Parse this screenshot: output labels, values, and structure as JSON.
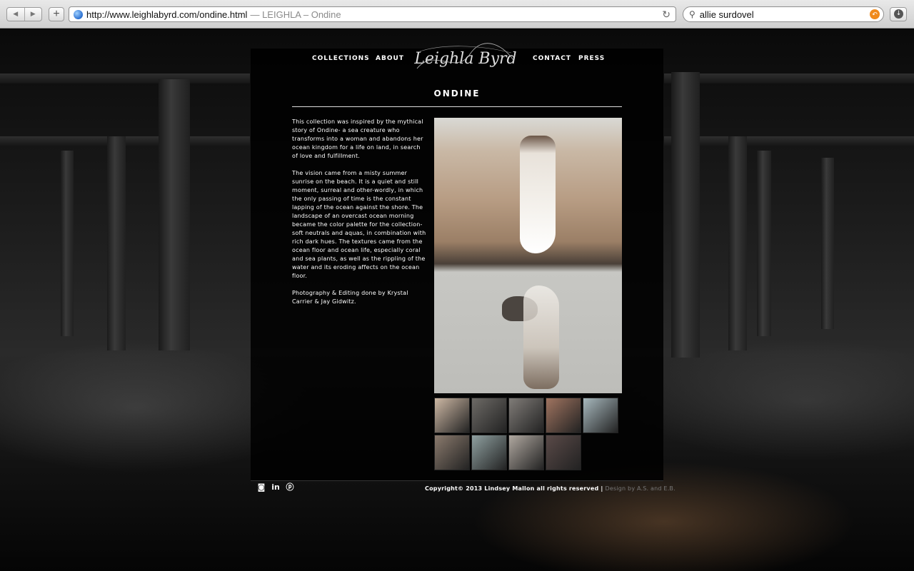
{
  "browser": {
    "url": "http://www.leighlabyrd.com/ondine.html",
    "page_title": "— LEIGHLA – Ondine",
    "search_value": "allie surdovel"
  },
  "nav": {
    "items": [
      "Collections",
      "About",
      "Contact",
      "Press"
    ],
    "logo_text": "Leighla Byrd"
  },
  "page": {
    "heading": "Ondine",
    "paragraphs": [
      "This collection was inspired by the mythical story of Ondine- a sea creature who transforms into a woman and abandons her ocean kingdom for a life on land, in search of love and fulfillment.",
      "The vision came from a misty summer sunrise on the beach. It is a quiet and still moment, surreal and other-wordly, in which the only passing of time is the constant lapping of the ocean against the shore. The landscape of an overcast ocean morning became the color palette for the collection- soft neutrals and aquas, in combination with rich dark hues. The textures came from the ocean floor and ocean life, especially coral and sea plants, as well as the rippling of the water and its eroding affects on the ocean floor.",
      "Photography & Editing done by Krystal Carrier & Jay Gidwitz."
    ]
  },
  "thumbnails": [
    {
      "color": "#cdb8a4"
    },
    {
      "color": "#6d6a66"
    },
    {
      "color": "#807c78"
    },
    {
      "color": "#a07460"
    },
    {
      "color": "#a7b8bd"
    },
    {
      "color": "#8a7a6d"
    },
    {
      "color": "#8fa0a0"
    },
    {
      "color": "#b0a8a0"
    },
    {
      "color": "#5a4a48"
    }
  ],
  "footer": {
    "social_icons": [
      "instagram-icon",
      "linkedin-icon",
      "pinterest-icon"
    ],
    "copyright": "Copyright© 2013 Lindsey Mallon all rights reserved |",
    "design_credit": "Design by A.S. and E.B."
  }
}
